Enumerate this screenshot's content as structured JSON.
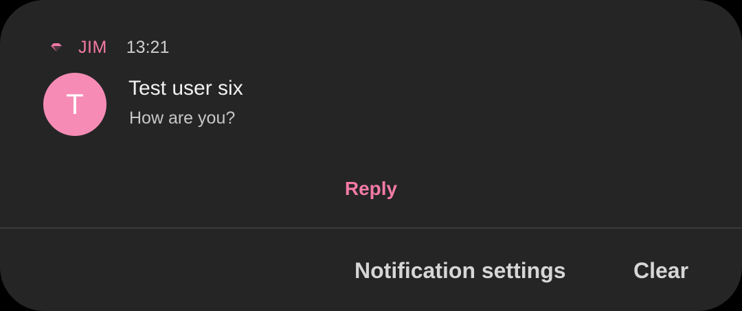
{
  "notification": {
    "app_icon": "jim-app-icon",
    "app_name": "JIM",
    "time": "13:21",
    "avatar_letter": "T",
    "title": "Test user six",
    "body": "How are you?",
    "reply_label": "Reply"
  },
  "footer": {
    "settings_label": "Notification settings",
    "clear_label": "Clear"
  },
  "colors": {
    "accent": "#f47aa6",
    "avatar": "#f68cb5",
    "card": "#252525",
    "background": "#000000"
  }
}
